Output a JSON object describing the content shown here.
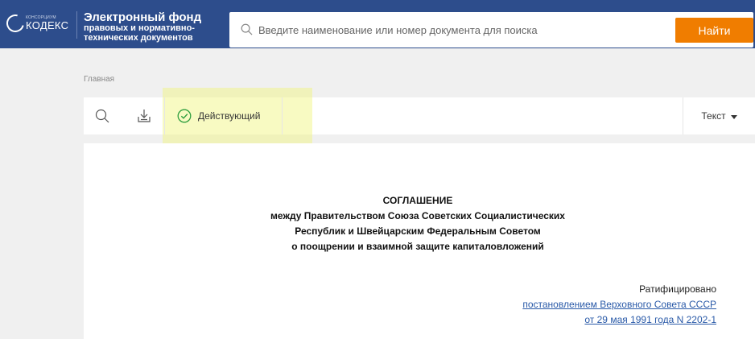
{
  "header": {
    "logo_small": "КОНСОРЦИУМ",
    "logo_big": "КОДЕКС",
    "fund_line1": "Электронный фонд",
    "fund_line2": "правовых и нормативно-",
    "fund_line3": "технических документов",
    "search_placeholder": "Введите наименование или номер документа для поиска",
    "search_value": "",
    "find_label": "Найти"
  },
  "breadcrumb": "Главная",
  "toolbar": {
    "status_label": "Действующий",
    "view_label": "Текст"
  },
  "document": {
    "title_lines": [
      "СОГЛАШЕНИЕ",
      "между Правительством Союза Советских Социалистических",
      "Республик и Швейцарским Федеральным Советом",
      "о поощрении и взаимной защите капиталовложений"
    ],
    "ratified": "Ратифицировано",
    "link_line1": "постановлением Верховного Совета СССР",
    "link_line2": "от 29 мая 1991 года N 2202-1"
  },
  "colors": {
    "header_bg": "#2d4d8c",
    "accent": "#f07d00",
    "status_green": "#2e9e3e",
    "link": "#2a5aa8"
  },
  "icons": {
    "search": "search-icon",
    "download": "download-icon",
    "status": "check-circle-icon",
    "view": "caret-down-icon"
  }
}
